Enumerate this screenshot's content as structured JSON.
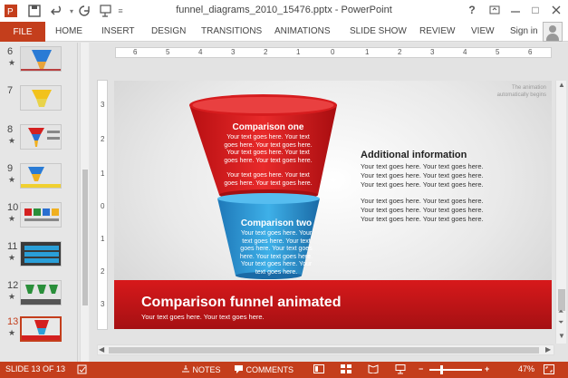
{
  "app": {
    "title": "funnel_diagrams_2010_15476.pptx - PowerPoint",
    "help": "?",
    "restore": "□"
  },
  "ribbon": {
    "file": "FILE",
    "tabs": [
      "HOME",
      "INSERT",
      "DESIGN",
      "TRANSITIONS",
      "ANIMATIONS",
      "SLIDE SHOW",
      "REVIEW",
      "VIEW"
    ],
    "signin": "Sign in"
  },
  "thumbnails": [
    {
      "num": "6",
      "star": "★"
    },
    {
      "num": "7",
      "star": ""
    },
    {
      "num": "8",
      "star": "★"
    },
    {
      "num": "9",
      "star": "★"
    },
    {
      "num": "10",
      "star": "★"
    },
    {
      "num": "11",
      "star": "★"
    },
    {
      "num": "12",
      "star": "★"
    },
    {
      "num": "13",
      "star": "★"
    }
  ],
  "ruler": {
    "h_labels": [
      "6",
      "5",
      "4",
      "3",
      "2",
      "1",
      "0",
      "1",
      "2",
      "3",
      "4",
      "5",
      "6"
    ],
    "v_labels": [
      "3",
      "2",
      "1",
      "0",
      "1",
      "2",
      "3"
    ]
  },
  "slide": {
    "animation_note_1": "The animation",
    "animation_note_2": "automatically begins",
    "funnel_top": {
      "title": "Comparison one",
      "line1": "Your text goes here. Your text goes here. Your text goes here. Your text goes here. Your text goes here. Your text goes here.",
      "line2": "Your text goes here. Your text goes here. Your text goes here."
    },
    "funnel_bottom": {
      "title": "Comparison two",
      "text": "Your text goes here. Your text goes here. Your text goes here. Your text goes here. Your text goes here. Your text goes here. Your text goes here."
    },
    "additional": {
      "title": "Additional information",
      "p1": "Your text goes here. Your text goes here. Your text goes here. Your text goes here. Your text goes here. Your text goes here.",
      "p2": "Your text goes here. Your text goes here. Your text goes here. Your text goes here. Your text goes here. Your text goes here."
    },
    "bar_title": "Comparison funnel animated",
    "bar_subtitle": "Your text goes here. Your text goes here.",
    "colors": {
      "red": "#d7191b",
      "blue": "#2f9fd8"
    }
  },
  "status": {
    "slide": "SLIDE 13 OF 13",
    "notes": "NOTES",
    "comments": "COMMENTS",
    "zoom": "47%"
  }
}
